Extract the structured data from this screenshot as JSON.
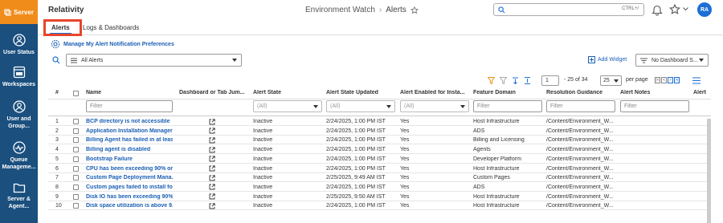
{
  "rail": {
    "brand": "Server",
    "items": [
      {
        "label1": "User Status",
        "label2": ""
      },
      {
        "label1": "Workspaces",
        "label2": ""
      },
      {
        "label1": "User and",
        "label2": "Group..."
      },
      {
        "label1": "Queue",
        "label2": "Manageme..."
      },
      {
        "label1": "Server &",
        "label2": "Agent..."
      }
    ]
  },
  "header": {
    "app_title": "Relativity",
    "breadcrumb_parent": "Environment Watch",
    "breadcrumb_current": "Alerts",
    "search_placeholder": "",
    "search_shortcut": "CTRL+/",
    "avatar_initials": "RA"
  },
  "tabs": [
    {
      "label": "Alerts",
      "active": true
    },
    {
      "label": "Logs & Dashboards",
      "active": false
    }
  ],
  "prefs_link": "Manage My Alert Notification Preferences",
  "view_select": "All Alerts",
  "add_widget": "Add Widget",
  "dashboard_select": "No Dashboard S...",
  "pager": {
    "page_value": "1",
    "range_text": "- 25 of 34",
    "per_page_value": "25",
    "per_page_label": "per page"
  },
  "columns": [
    "#",
    "Name",
    "Dashboard or Tab Jum...",
    "Alert State",
    "Alert State Updated",
    "Alert Enabled for Insta...",
    "Feature Domain",
    "Resolution Guidance",
    "Alert Notes",
    "Alert"
  ],
  "filters": {
    "name": "Filter",
    "state": "(All)",
    "updated": "(All)",
    "enabled": "(All)",
    "domain": "Filter",
    "guidance": "Filter",
    "notes": "Filter"
  },
  "rows": [
    {
      "num": "1",
      "name": "BCP directory is not accessible",
      "state": "Inactive",
      "updated": "2/24/2025, 1:00 PM IST",
      "enabled": "Yes",
      "domain": "Host Infrastructure",
      "guidance": "/Content/Environment_W..."
    },
    {
      "num": "2",
      "name": "Application Installation Manager ...",
      "state": "Inactive",
      "updated": "2/24/2025, 1:00 PM IST",
      "enabled": "Yes",
      "domain": "ADS",
      "guidance": "/Content/Environment_W..."
    },
    {
      "num": "3",
      "name": "Billing Agent has failed in at leas...",
      "state": "Inactive",
      "updated": "2/24/2025, 1:00 PM IST",
      "enabled": "Yes",
      "domain": "Billing and Licensing",
      "guidance": "/Content/Environment_W..."
    },
    {
      "num": "4",
      "name": "Billing agent is disabled",
      "state": "Inactive",
      "updated": "2/24/2025, 1:00 PM IST",
      "enabled": "Yes",
      "domain": "Agents",
      "guidance": "/Content/Environment_W..."
    },
    {
      "num": "5",
      "name": "Bootstrap Failure",
      "state": "Inactive",
      "updated": "2/24/2025, 1:00 PM IST",
      "enabled": "Yes",
      "domain": "Developer Platform",
      "guidance": "/Content/Environment_W..."
    },
    {
      "num": "6",
      "name": "CPU has been exceeding 90% on ...",
      "state": "Inactive",
      "updated": "2/24/2025, 1:00 PM IST",
      "enabled": "Yes",
      "domain": "Host Infrastructure",
      "guidance": "/Content/Environment_W..."
    },
    {
      "num": "7",
      "name": "Custom Page Deployment Mana...",
      "state": "Inactive",
      "updated": "2/25/2025, 9:49 AM IST",
      "enabled": "Yes",
      "domain": "Custom Pages",
      "guidance": "/Content/Environment_W..."
    },
    {
      "num": "8",
      "name": "Custom pages failed to install for...",
      "state": "Inactive",
      "updated": "2/24/2025, 1:00 PM IST",
      "enabled": "Yes",
      "domain": "ADS",
      "guidance": "/Content/Environment_W..."
    },
    {
      "num": "9",
      "name": "Disk IO has been exceeding 90% ...",
      "state": "Inactive",
      "updated": "2/25/2025, 9:50 AM IST",
      "enabled": "Yes",
      "domain": "Host Infrastructure",
      "guidance": "/Content/Environment_W..."
    },
    {
      "num": "10",
      "name": "Disk space utilization is above 9...",
      "state": "Inactive",
      "updated": "2/24/2025, 1:00 PM IST",
      "enabled": "Yes",
      "domain": "Host Infrastructure",
      "guidance": "/Content/Environment_W..."
    }
  ],
  "colors": {
    "rail": "#1a4f7e",
    "brand": "#f08c1a",
    "accent": "#1d6fd5",
    "link": "#1a5fb4",
    "highlight": "#e8452a"
  }
}
